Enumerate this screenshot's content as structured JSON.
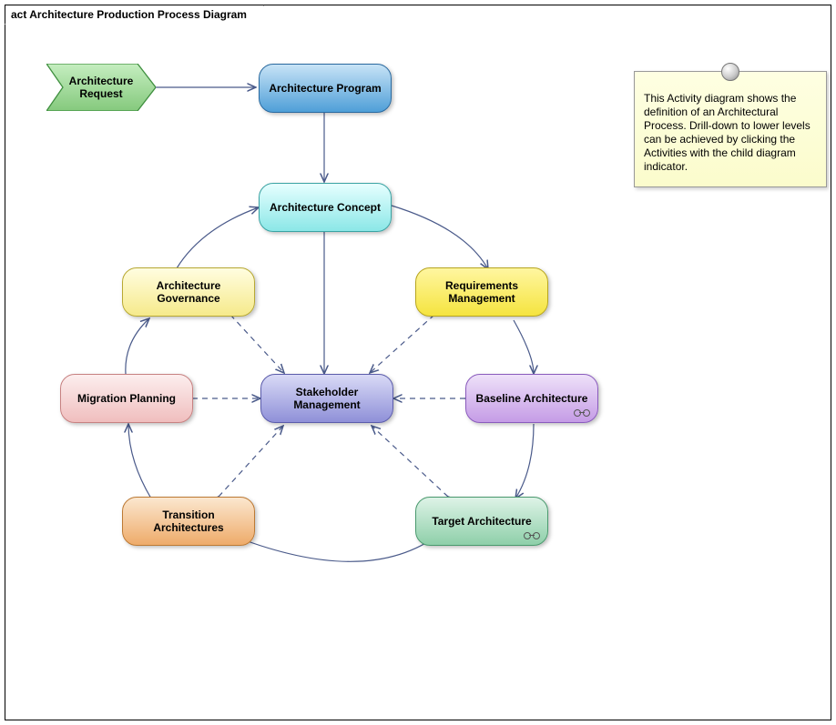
{
  "diagram": {
    "title_prefix": "act",
    "title": "Architecture Production Process Diagram"
  },
  "nodes": {
    "request": {
      "label": "Architecture Request"
    },
    "program": {
      "label": "Architecture Program"
    },
    "concept": {
      "label": "Architecture Concept"
    },
    "governance": {
      "label": "Architecture Governance"
    },
    "requirements": {
      "label": "Requirements Management"
    },
    "migration": {
      "label": "Migration Planning"
    },
    "stakeholder": {
      "label": "Stakeholder Management"
    },
    "baseline": {
      "label": "Baseline Architecture"
    },
    "transition": {
      "label": "Transition Architectures"
    },
    "target": {
      "label": "Target Architecture"
    }
  },
  "note": {
    "text": "This Activity diagram shows the definition of an Architectural Process. Drill-down to lower levels can be achieved by clicking the Activities with the child diagram indicator."
  },
  "colors": {
    "request": "#9FD998",
    "program": "#6FB6E6",
    "concept": "#B4F3F3",
    "governance": "#FCF3A8",
    "requirements": "#FAEE62",
    "migration": "#F6D3D3",
    "stakeholder": "#A7A8E6",
    "baseline": "#D4B8EE",
    "transition": "#F3C086",
    "target": "#A8DEBF"
  }
}
